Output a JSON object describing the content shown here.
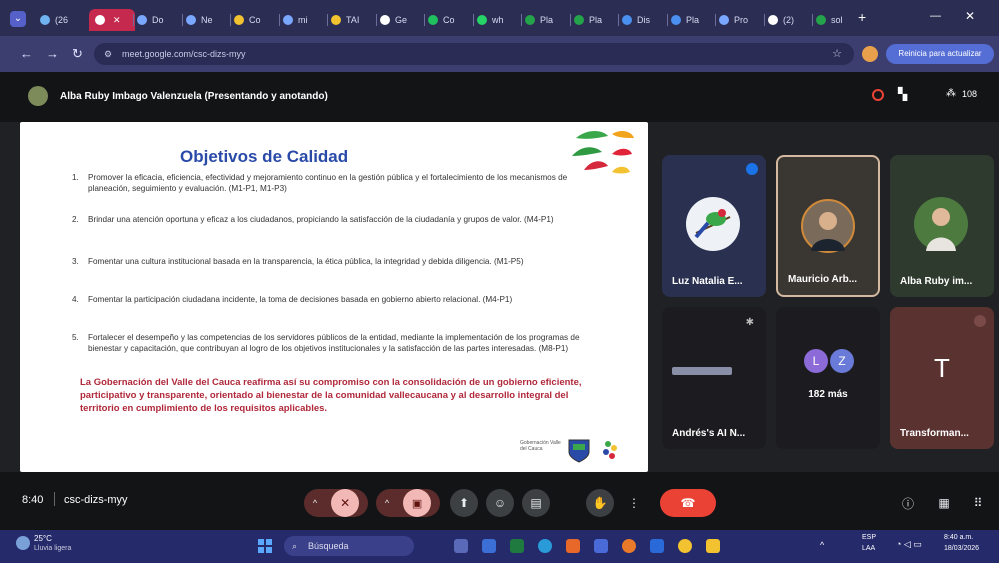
{
  "browser": {
    "tabs": [
      {
        "label": "(26",
        "color": "#6fb3f0"
      },
      {
        "label": "",
        "color": "#ffffff"
      },
      {
        "label": "Do",
        "color": "#7aa7ff"
      },
      {
        "label": "Ne",
        "color": "#7aa7ff"
      },
      {
        "label": "Co",
        "color": "#f2c230"
      },
      {
        "label": "mi",
        "color": "#7aa7ff"
      },
      {
        "label": "TAI",
        "color": "#f2c230"
      },
      {
        "label": "Ge",
        "color": "#ffffff"
      },
      {
        "label": "Co",
        "color": "#20c05e"
      },
      {
        "label": "wh",
        "color": "#25d366"
      },
      {
        "label": "Pla",
        "color": "#25a34a"
      },
      {
        "label": "Pla",
        "color": "#25a34a"
      },
      {
        "label": "Dis",
        "color": "#4a90f0"
      },
      {
        "label": "Pla",
        "color": "#4a90f0"
      },
      {
        "label": "Pro",
        "color": "#7aa7ff"
      },
      {
        "label": "(2)",
        "color": "#ffffff"
      },
      {
        "label": "sol",
        "color": "#25a34a"
      }
    ],
    "new_tab": "+",
    "url": "meet.google.com/csc-dizs-myy",
    "update_button": "Reinicia para actualizar"
  },
  "meet": {
    "presenter_label": "Alba Ruby Imbago Valenzuela (Presentando y anotando)",
    "participant_count": "108",
    "time": "8:40",
    "meeting_code": "csc-dizs-myy"
  },
  "slide": {
    "title": "Objetivos de Calidad",
    "objectives": [
      {
        "num": "1.",
        "text": "Promover la eficacia, eficiencia, efectividad y mejoramiento continuo en la gestión pública y el fortalecimiento de los mecanismos de planeación, seguimiento y evaluación. (M1-P1, M1-P3)"
      },
      {
        "num": "2.",
        "text": "Brindar una atención oportuna y eficaz a los ciudadanos, propiciando la satisfacción de la ciudadanía y grupos de valor. (M4-P1)"
      },
      {
        "num": "3.",
        "text": "Fomentar una cultura institucional basada en la transparencia, la ética pública, la integridad y debida diligencia. (M1-P5)"
      },
      {
        "num": "4.",
        "text": "Fomentar la participación ciudadana incidente, la toma de decisiones basada en gobierno abierto relacional. (M4-P1)"
      },
      {
        "num": "5.",
        "text": "Fortalecer el desempeño y las competencias de los servidores públicos de la entidad, mediante la implementación de los programas de bienestar y capacitación, que contribuyan al logro de los objetivos institucionales y la satisfacción de las partes interesadas. (M8-P1)"
      }
    ],
    "closing": "La Gobernación del Valle del Cauca reafirma así su compromiso con la consolidación de un gobierno eficiente, participativo y transparente, orientado al bienestar de la comunidad vallecaucana y al desarrollo integral del territorio en cumplimiento de los requisitos aplicables.",
    "footer_logo_text": "Gobernación Valle del Cauca"
  },
  "participants": [
    {
      "name": "Luz Natalia E..."
    },
    {
      "name": "Mauricio Arb..."
    },
    {
      "name": "Alba Ruby im..."
    },
    {
      "name": "Andrés's AI N..."
    },
    {
      "name": "182 más",
      "initials": [
        "L",
        "Z"
      ]
    },
    {
      "name": "Transforman...",
      "initial": "T"
    }
  ],
  "taskbar": {
    "weather_temp": "25°C",
    "weather_desc": "Lluvia ligera",
    "search": "Búsqueda",
    "lang_top": "ESP",
    "lang_bottom": "LAA",
    "clock_time": "8:40 a.m.",
    "clock_date": "18/03/2026"
  }
}
